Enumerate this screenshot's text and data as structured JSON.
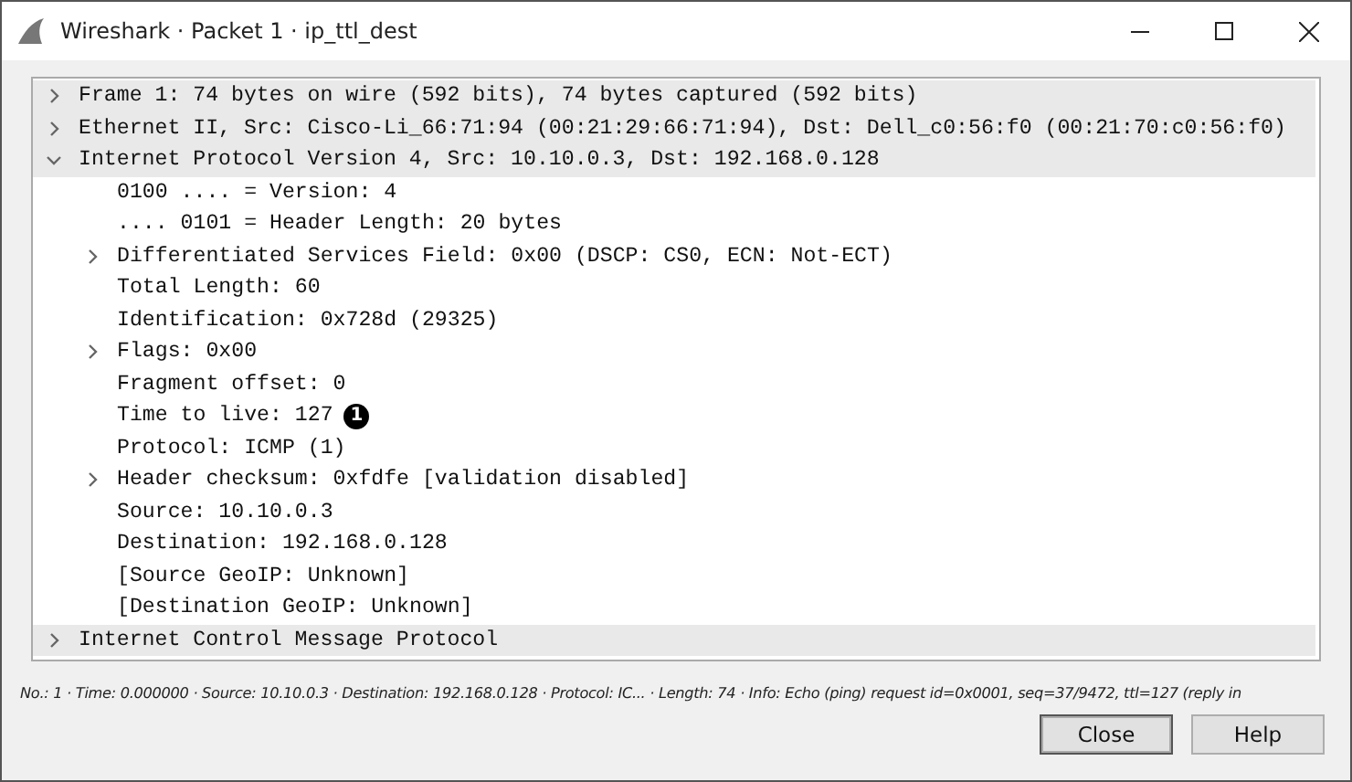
{
  "window": {
    "title": "Wireshark · Packet 1 · ip_ttl_dest"
  },
  "tree": [
    {
      "label": "Frame 1: 74 bytes on wire (592 bits), 74 bytes captured (592 bits)",
      "expanded": false
    },
    {
      "label": "Ethernet II, Src: Cisco-Li_66:71:94 (00:21:29:66:71:94), Dst: Dell_c0:56:f0 (00:21:70:c0:56:f0)",
      "expanded": false
    },
    {
      "label": "Internet Protocol Version 4, Src: 10.10.0.3, Dst: 192.168.0.128",
      "expanded": true,
      "children": [
        {
          "label": "0100 .... = Version: 4"
        },
        {
          "label": ".... 0101 = Header Length: 20 bytes"
        },
        {
          "label": "Differentiated Services Field: 0x00 (DSCP: CS0, ECN: Not-ECT)",
          "expanded": false
        },
        {
          "label": "Total Length: 60"
        },
        {
          "label": "Identification: 0x728d (29325)"
        },
        {
          "label": "Flags: 0x00",
          "expanded": false
        },
        {
          "label": "Fragment offset: 0"
        },
        {
          "label": "Time to live: 127",
          "callout": "1"
        },
        {
          "label": "Protocol: ICMP (1)"
        },
        {
          "label": "Header checksum: 0xfdfe [validation disabled]",
          "expanded": false
        },
        {
          "label": "Source: 10.10.0.3"
        },
        {
          "label": "Destination: 192.168.0.128"
        },
        {
          "label": "[Source GeoIP: Unknown]"
        },
        {
          "label": "[Destination GeoIP: Unknown]"
        }
      ]
    },
    {
      "label": "Internet Control Message Protocol",
      "expanded": false
    }
  ],
  "status_line": "No.: 1 · Time: 0.000000 · Source: 10.10.0.3 · Destination: 192.168.0.128 · Protocol: IC... · Length: 74 · Info: Echo (ping) request id=0x0001, seq=37/9472, ttl=127 (reply in",
  "buttons": [
    "Close",
    "Help"
  ]
}
